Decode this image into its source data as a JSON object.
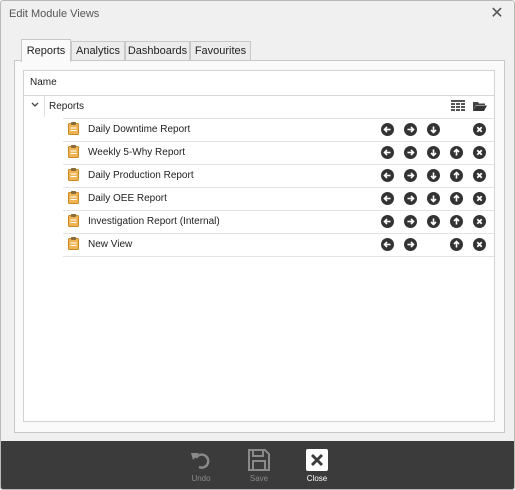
{
  "window": {
    "title": "Edit Module Views",
    "close_glyph": "✕"
  },
  "tabs": [
    {
      "label": "Reports",
      "active": true
    },
    {
      "label": "Analytics",
      "active": false
    },
    {
      "label": "Dashboards",
      "active": false
    },
    {
      "label": "Favourites",
      "active": false
    }
  ],
  "tree": {
    "column_header": "Name",
    "root": {
      "label": "Reports",
      "expanded": true,
      "icons": [
        "grid-view-icon",
        "folder-open-icon"
      ]
    },
    "items": [
      {
        "label": "Daily Downtime Report",
        "actions": [
          "move-left",
          "move-right",
          "move-down",
          "delete"
        ]
      },
      {
        "label": "Weekly 5-Why Report",
        "actions": [
          "move-left",
          "move-right",
          "move-down",
          "move-up",
          "delete"
        ]
      },
      {
        "label": "Daily Production Report",
        "actions": [
          "move-left",
          "move-right",
          "move-down",
          "move-up",
          "delete"
        ]
      },
      {
        "label": "Daily OEE Report",
        "actions": [
          "move-left",
          "move-right",
          "move-down",
          "move-up",
          "delete"
        ]
      },
      {
        "label": "Investigation Report (Internal)",
        "actions": [
          "move-left",
          "move-right",
          "move-down",
          "move-up",
          "delete"
        ]
      },
      {
        "label": "New View",
        "actions": [
          "move-left",
          "move-right",
          "move-up",
          "delete"
        ]
      }
    ]
  },
  "footer": {
    "undo": {
      "label": "Undo",
      "enabled": false
    },
    "save": {
      "label": "Save",
      "enabled": false
    },
    "close": {
      "label": "Close",
      "enabled": true
    }
  },
  "colors": {
    "accent_dark": "#333333",
    "footer_bg": "#3b3b3b",
    "doc_icon": "#e6a23c"
  }
}
